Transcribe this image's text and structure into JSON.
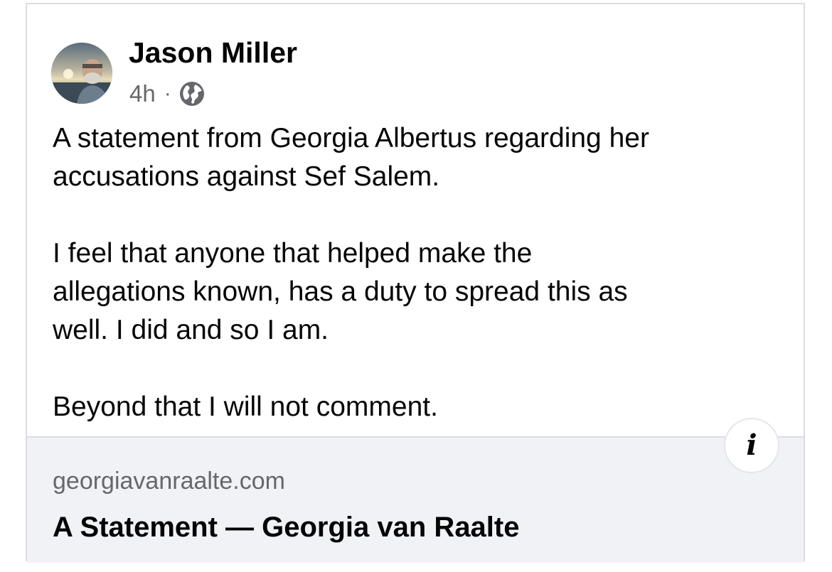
{
  "post": {
    "author": "Jason Miller",
    "timestamp": "4h",
    "separator": "·",
    "audience_icon": "globe-icon",
    "avatar_icon": "profile-photo",
    "paragraphs": [
      "A statement from Georgia Albertus regarding her\naccusations against Sef Salem.",
      "I feel that anyone that helped make the\nallegations known, has a duty to spread this as\nwell. I did and so I am.",
      "Beyond that I will not comment."
    ]
  },
  "link_preview": {
    "domain": "georgiavanraalte.com",
    "title": "A Statement — Georgia van Raalte",
    "info_icon": "info-icon",
    "info_glyph": "i"
  },
  "colors": {
    "text_primary": "#050505",
    "text_secondary": "#65676b",
    "preview_background": "#f0f2f5",
    "border": "#dadde1"
  }
}
